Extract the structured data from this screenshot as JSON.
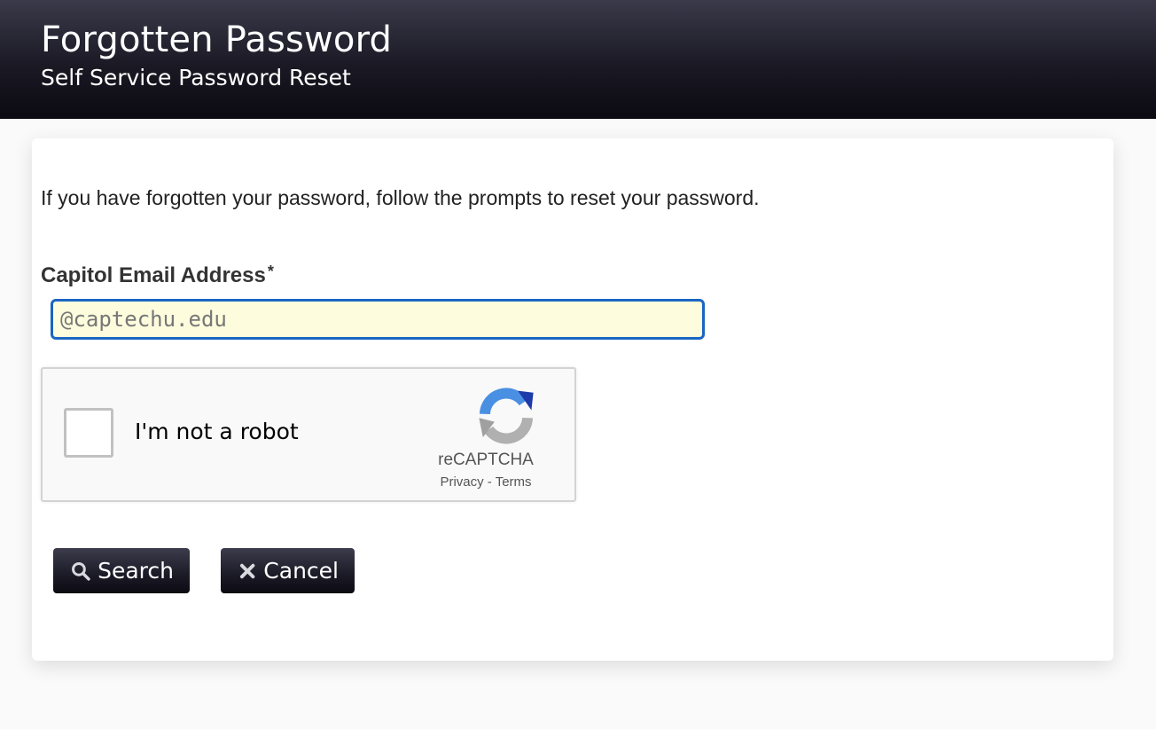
{
  "header": {
    "title": "Forgotten Password",
    "subtitle": "Self Service Password Reset"
  },
  "form": {
    "intro_text": "If you have forgotten your password, follow the prompts to reset your password.",
    "email_label": "Capitol Email Address",
    "required_marker": "*",
    "email_placeholder": "@captechu.edu",
    "email_value": ""
  },
  "captcha": {
    "label": "I'm not a robot",
    "brand": "reCAPTCHA",
    "privacy": "Privacy",
    "separator": "-",
    "terms": "Terms",
    "checked": false
  },
  "buttons": {
    "search_label": "Search",
    "cancel_label": "Cancel"
  },
  "icons": {
    "search": "search-icon",
    "cancel": "close-icon",
    "captcha_logo": "recaptcha-logo-icon"
  },
  "colors": {
    "header_dark": "#0b0a12",
    "input_focus_border": "#1a66c2",
    "input_bg": "#fdfdde"
  }
}
